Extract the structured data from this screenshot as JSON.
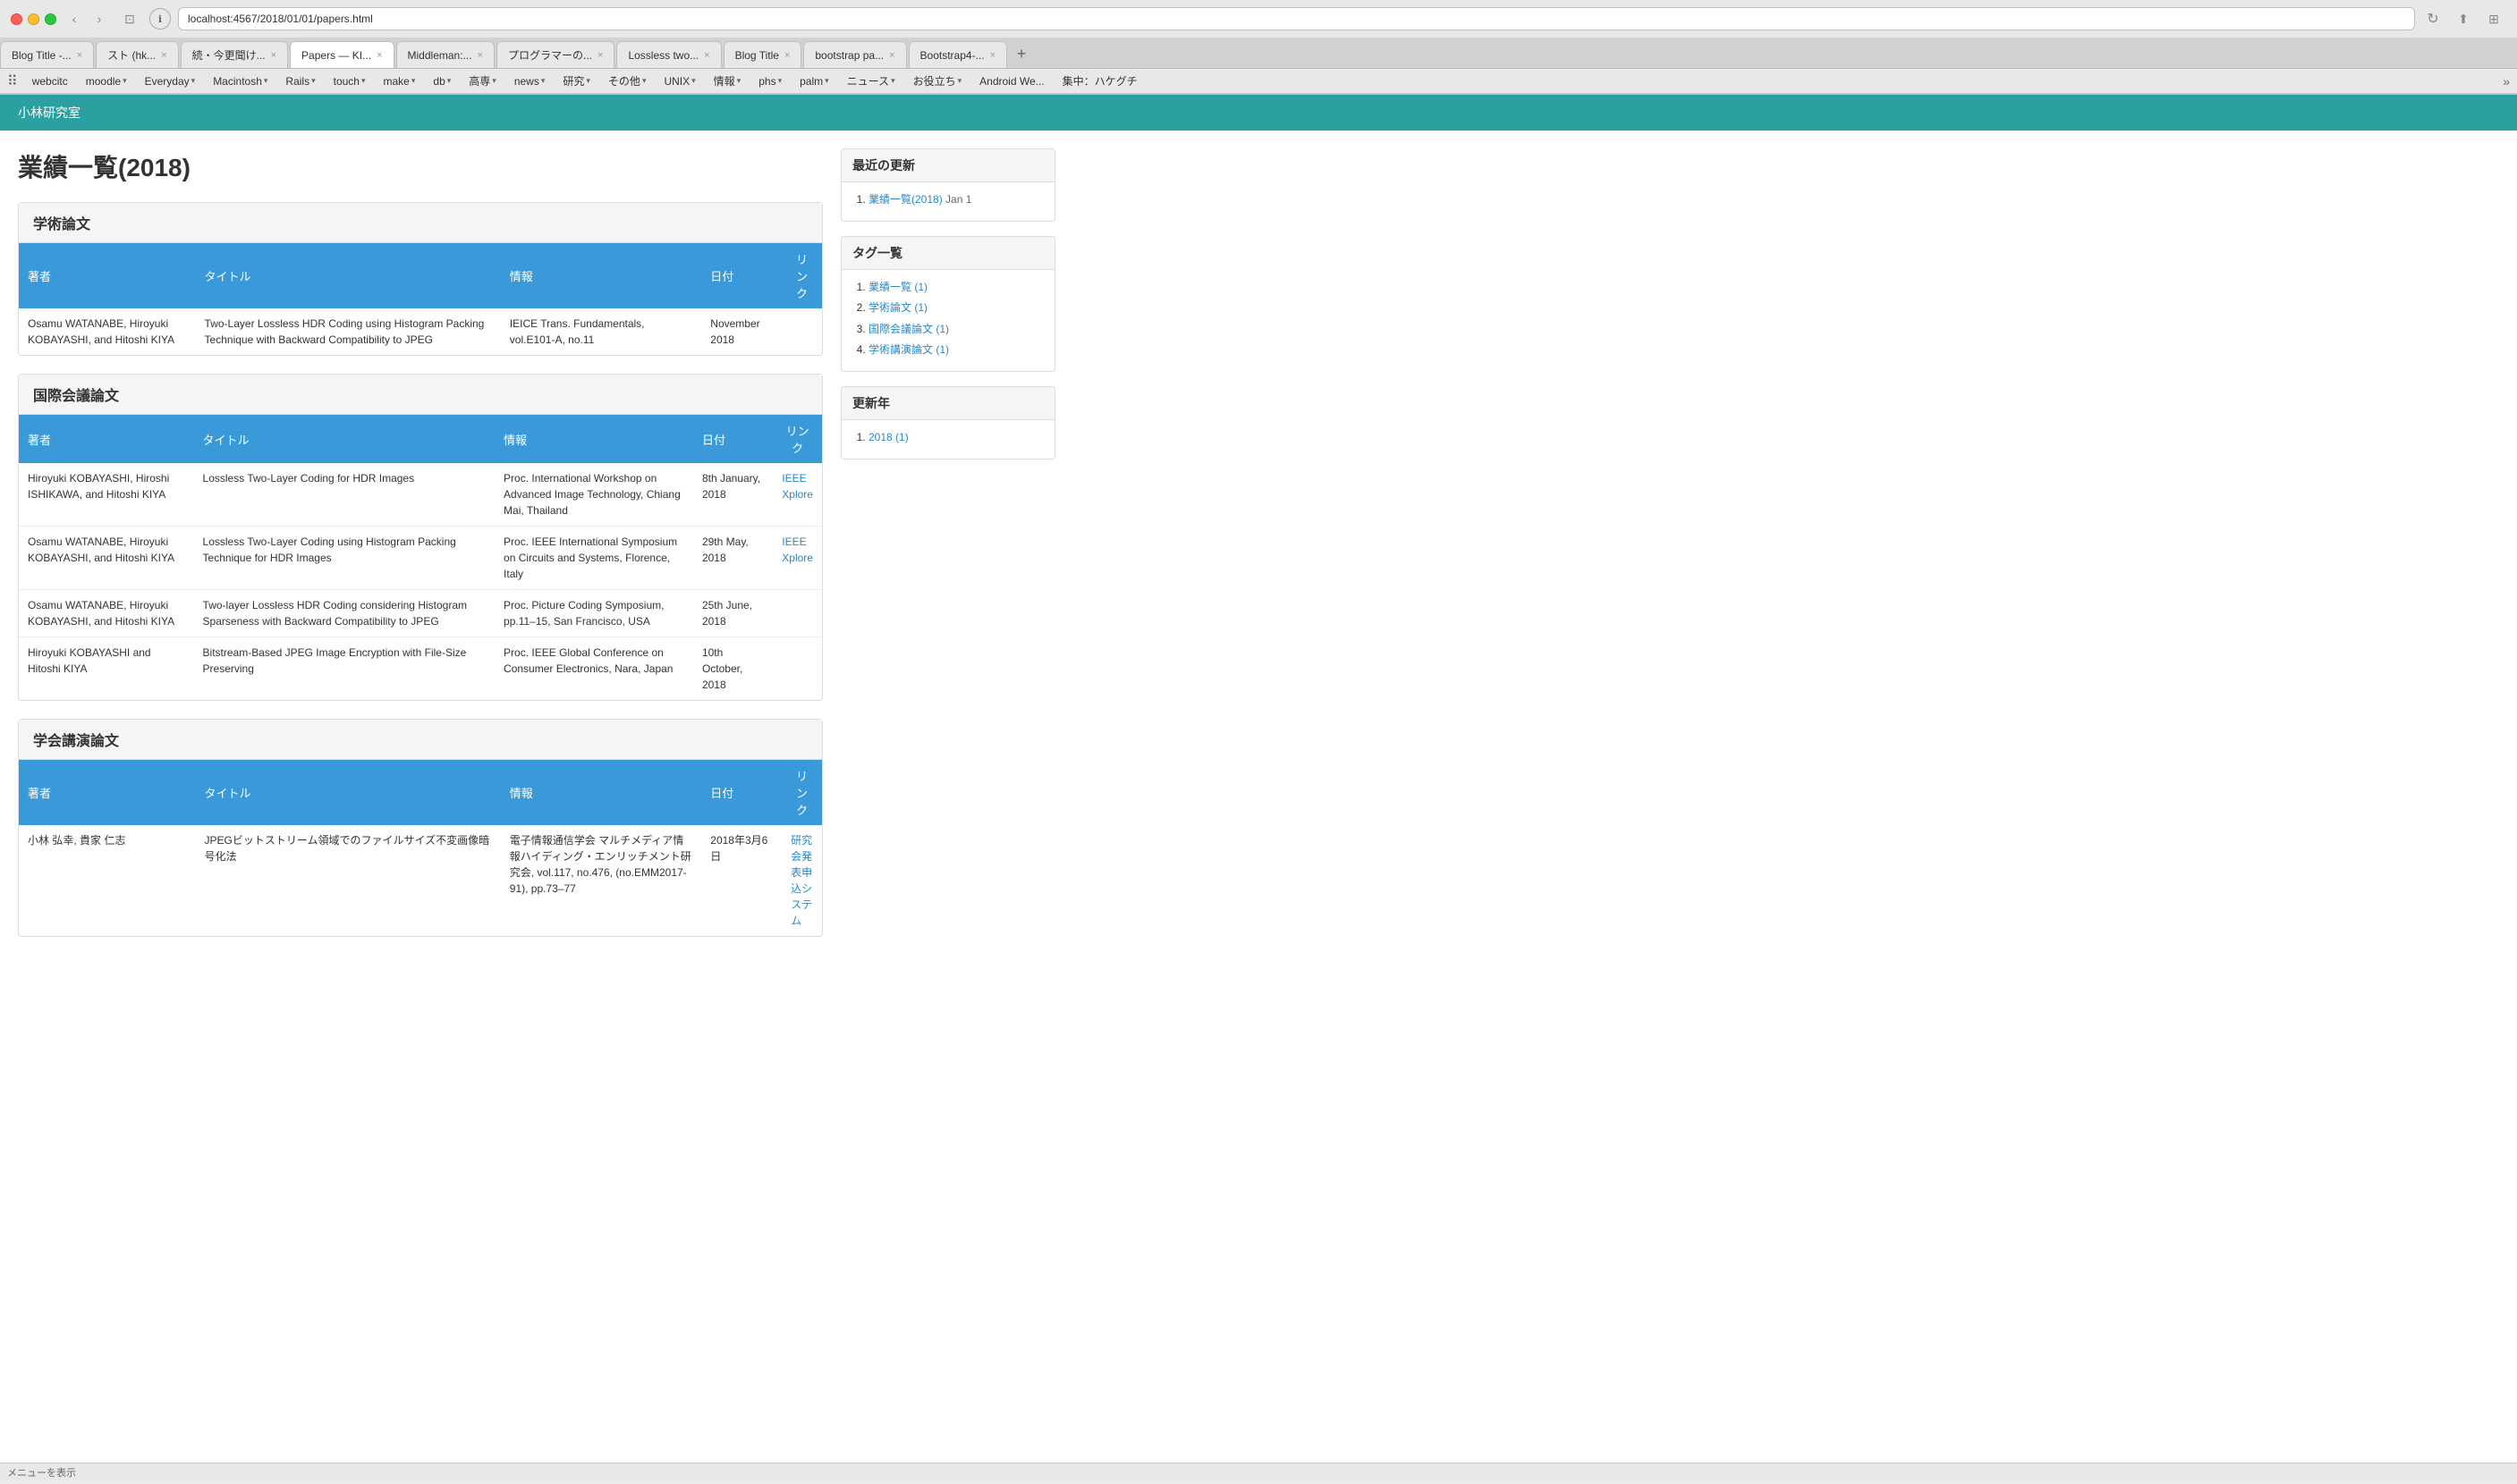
{
  "browser": {
    "url": "localhost:4567/2018/01/01/papers.html",
    "tabs": [
      {
        "label": "Blog Title -...",
        "active": false
      },
      {
        "label": "スト (hk...",
        "active": false
      },
      {
        "label": "続・今更聞け...",
        "active": false
      },
      {
        "label": "Papers — KI...",
        "active": true
      },
      {
        "label": "Middleman:...",
        "active": false
      },
      {
        "label": "プログラマーの...",
        "active": false
      },
      {
        "label": "Lossless two...",
        "active": false
      },
      {
        "label": "Blog Title",
        "active": false
      },
      {
        "label": "bootstrap pa...",
        "active": false
      },
      {
        "label": "Bootstrap4-...",
        "active": false
      }
    ],
    "bookmarks": [
      {
        "label": "webcitc",
        "dropdown": false
      },
      {
        "label": "moodle",
        "dropdown": true
      },
      {
        "label": "Everyday",
        "dropdown": true
      },
      {
        "label": "Macintosh",
        "dropdown": true
      },
      {
        "label": "Rails",
        "dropdown": true
      },
      {
        "label": "touch",
        "dropdown": true
      },
      {
        "label": "make",
        "dropdown": true
      },
      {
        "label": "db",
        "dropdown": true
      },
      {
        "label": "高専",
        "dropdown": true
      },
      {
        "label": "news",
        "dropdown": true
      },
      {
        "label": "研究",
        "dropdown": true
      },
      {
        "label": "その他",
        "dropdown": true
      },
      {
        "label": "UNIX",
        "dropdown": true
      },
      {
        "label": "情報",
        "dropdown": true
      },
      {
        "label": "phs",
        "dropdown": true
      },
      {
        "label": "palm",
        "dropdown": true
      },
      {
        "label": "ニュース",
        "dropdown": true
      },
      {
        "label": "お役立ち",
        "dropdown": true
      },
      {
        "label": "Android We...",
        "dropdown": false
      },
      {
        "label": "集中：ハケグチ",
        "dropdown": false
      }
    ]
  },
  "site": {
    "header_title": "小林研究室",
    "page_title": "業績一覧(2018)"
  },
  "academic_section": {
    "title": "学術論文",
    "table_headers": {
      "author": "著者",
      "title": "タイトル",
      "info": "情報",
      "date": "日付",
      "link": "リンク"
    },
    "rows": [
      {
        "author": "Osamu WATANABE, Hiroyuki KOBAYASHI, and Hitoshi KIYA",
        "title": "Two-Layer Lossless HDR Coding using Histogram Packing Technique with Backward Compatibility to JPEG",
        "info": "IEICE Trans. Fundamentals, vol.E101-A, no.11",
        "date": "November 2018",
        "link": ""
      }
    ]
  },
  "international_section": {
    "title": "国際会議論文",
    "table_headers": {
      "author": "著者",
      "title": "タイトル",
      "info": "情報",
      "date": "日付",
      "link": "リンク"
    },
    "rows": [
      {
        "author": "Hiroyuki KOBAYASHI, Hiroshi ISHIKAWA, and Hitoshi KIYA",
        "title": "Lossless Two-Layer Coding for HDR Images",
        "info": "Proc. International Workshop on Advanced Image Technology, Chiang Mai, Thailand",
        "date": "8th January, 2018",
        "links": [
          {
            "text": "IEEE",
            "url": "#"
          },
          {
            "text": "Xplore",
            "url": "#"
          }
        ]
      },
      {
        "author": "Osamu WATANABE, Hiroyuki KOBAYASHI, and Hitoshi KIYA",
        "title": "Lossless Two-Layer Coding using Histogram Packing Technique for HDR Images",
        "info": "Proc. IEEE International Symposium on Circuits and Systems, Florence, Italy",
        "date": "29th May, 2018",
        "links": [
          {
            "text": "IEEE",
            "url": "#"
          },
          {
            "text": "Xplore",
            "url": "#"
          }
        ]
      },
      {
        "author": "Osamu WATANABE, Hiroyuki KOBAYASHI, and Hitoshi KIYA",
        "title": "Two-layer Lossless HDR Coding considering Histogram Sparseness with Backward Compatibility to JPEG",
        "info": "Proc. Picture Coding Symposium, pp.11–15, San Francisco, USA",
        "date": "25th June, 2018",
        "links": []
      },
      {
        "author": "Hiroyuki KOBAYASHI and Hitoshi KIYA",
        "title": "Bitstream-Based JPEG Image Encryption with File-Size Preserving",
        "info": "Proc. IEEE Global Conference on Consumer Electronics, Nara, Japan",
        "date": "10th October, 2018",
        "links": []
      }
    ]
  },
  "domestic_section": {
    "title": "学会講演論文",
    "table_headers": {
      "author": "著者",
      "title": "タイトル",
      "info": "情報",
      "date": "日付",
      "link": "リンク"
    },
    "rows": [
      {
        "author": "小林 弘幸, 貴家 仁志",
        "title": "JPEGビットストリーム領域でのファイルサイズ不変画像暗号化法",
        "info": "電子情報通信学会 マルチメディア情報ハイディング・エンリッチメント研究会, vol.117, no.476, (no.EMM2017-91), pp.73–77",
        "date": "2018年3月6日",
        "link_text": "研究会発表申込システム",
        "link_url": "#"
      }
    ]
  },
  "sidebar": {
    "recent_updates": {
      "title": "最近の更新",
      "items": [
        {
          "text": "業績一覧(2018)",
          "date": "Jan 1",
          "url": "#"
        }
      ]
    },
    "tags": {
      "title": "タグ一覧",
      "items": [
        {
          "text": "業績一覧 (1)",
          "url": "#"
        },
        {
          "text": "学術論文 (1)",
          "url": "#"
        },
        {
          "text": "国際会議論文 (1)",
          "url": "#"
        },
        {
          "text": "学術講演論文 (1)",
          "url": "#"
        }
      ]
    },
    "years": {
      "title": "更新年",
      "items": [
        {
          "text": "2018 (1)",
          "url": "#"
        }
      ]
    }
  },
  "status_bar": {
    "left": "メニューを表示",
    "right": ""
  }
}
